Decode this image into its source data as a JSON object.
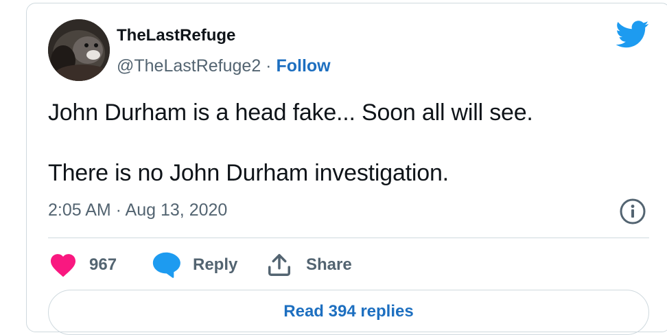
{
  "tweet": {
    "author_name": "TheLastRefuge",
    "handle": "@TheLastRefuge2",
    "separator": " · ",
    "follow_label": "Follow",
    "text_line1": "John Durham is a head fake...  Soon all will see.",
    "text_line2": "There is no John Durham investigation.",
    "timestamp": "2:05 AM · Aug 13, 2020"
  },
  "actions": {
    "like_count": "967",
    "reply_label": "Reply",
    "share_label": "Share"
  },
  "read_replies_label": "Read 394 replies",
  "colors": {
    "twitter_blue": "#1d9bf0",
    "link_blue": "#1d6fc0",
    "like_pink": "#f91880",
    "muted_gray": "#536471",
    "border": "#cfd9de"
  },
  "icons": [
    "twitter-bird-icon",
    "info-icon",
    "heart-icon",
    "reply-bubble-icon",
    "share-icon"
  ]
}
